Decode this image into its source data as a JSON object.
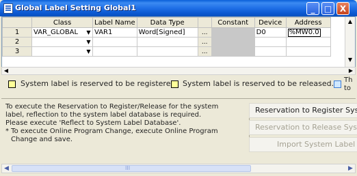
{
  "window": {
    "title": "Global Label Setting Global1",
    "buttons": {
      "minimize": "_",
      "maximize": "□",
      "close": "X"
    }
  },
  "grid": {
    "columns": [
      "",
      "Class",
      "Label Name",
      "Data Type",
      "",
      "Constant",
      "Device",
      "Address"
    ],
    "rows": [
      {
        "num": "1",
        "class": "VAR_GLOBAL",
        "label": "VAR1",
        "type": "Word[Signed]",
        "constant": "",
        "device": "D0",
        "address": "%MW0.0"
      },
      {
        "num": "2",
        "class": "",
        "label": "",
        "type": "",
        "constant": "",
        "device": "",
        "address": ""
      },
      {
        "num": "3",
        "class": "",
        "label": "",
        "type": "",
        "constant": "",
        "device": "",
        "address": ""
      }
    ],
    "ellipsis": "..."
  },
  "legend": {
    "item1": "System label is reserved to be registered.",
    "item2": "System label is reserved to be released.",
    "item3_line1": "Th",
    "item3_line2": "to",
    "colors": {
      "yellow": "#ffff99",
      "blue": "#cfe8ff"
    }
  },
  "info": {
    "lines": [
      "To execute the Reservation to Register/Release for the system",
      "label, reflection to the system label database is required.",
      "Please execute 'Reflect to System Label Database'.",
      "* To execute Online Program Change, execute Online Program",
      "  Change and save."
    ]
  },
  "buttons": {
    "reserve_register": "Reservation to Register System",
    "reserve_release": "Reservation to Release System",
    "import": "Import System Label"
  },
  "scroll": {
    "thumb_grip": "III"
  }
}
